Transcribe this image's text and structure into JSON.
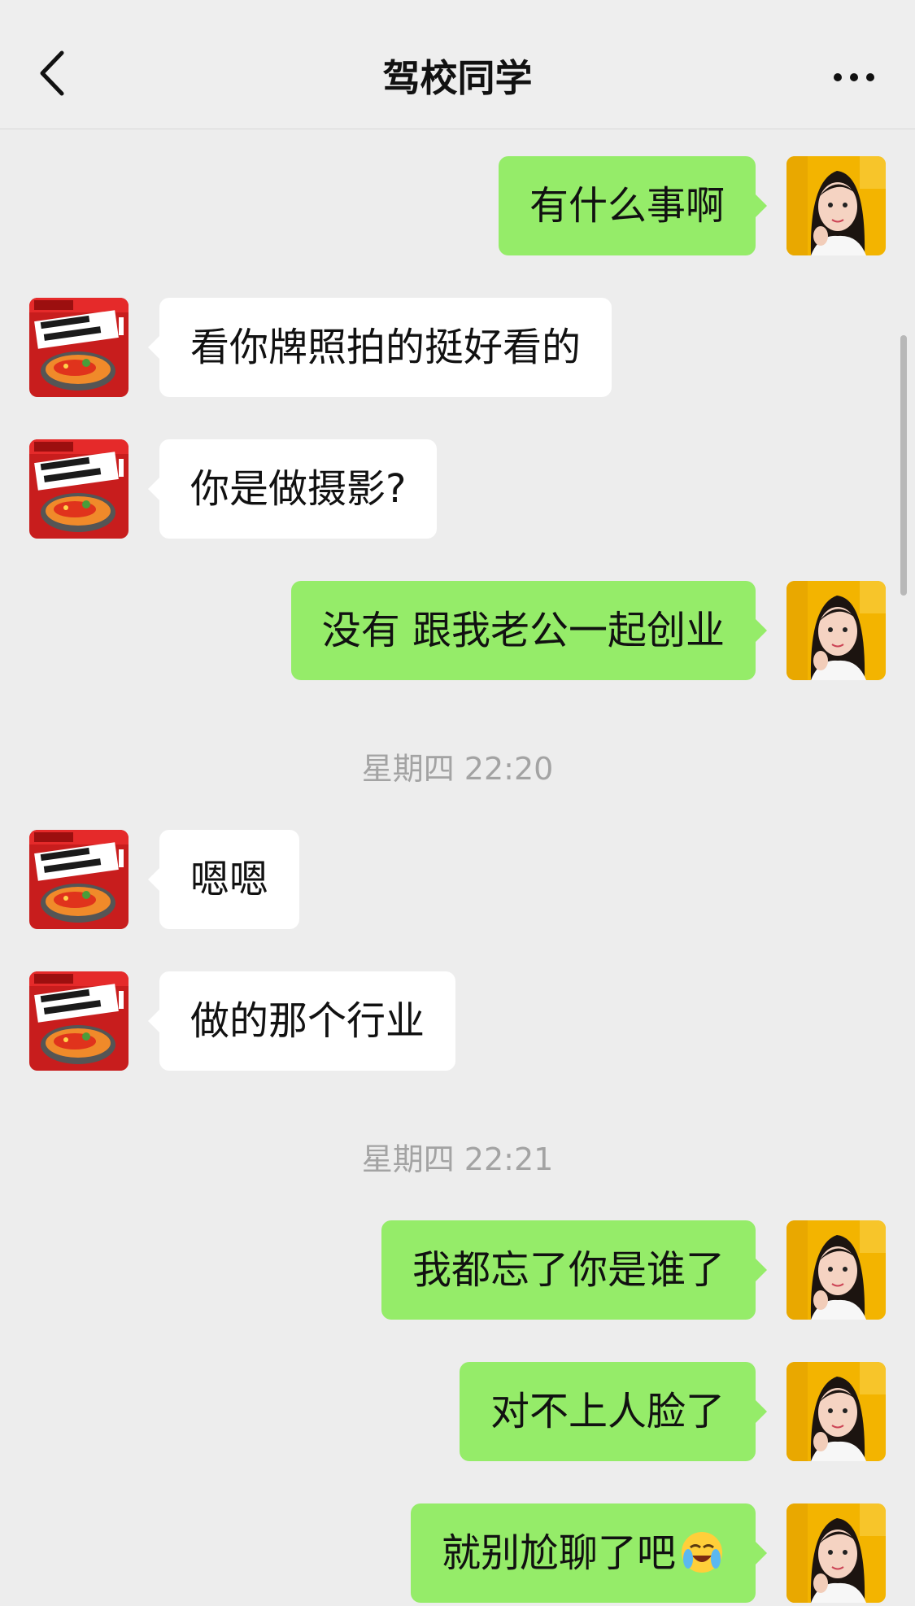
{
  "header": {
    "title": "驾校同学",
    "back_icon": "chevron-left-icon",
    "more_icon": "more-dots-icon"
  },
  "colors": {
    "self_bubble": "#95ec69",
    "other_bubble": "#ffffff",
    "background": "#ededed",
    "timestamp": "#a3a3a3"
  },
  "messages": [
    {
      "sender": "self",
      "text": "有什么事啊"
    },
    {
      "sender": "other",
      "text": "看你牌照拍的挺好看的"
    },
    {
      "sender": "other",
      "text": "你是做摄影?"
    },
    {
      "sender": "self",
      "text": "没有 跟我老公一起创业"
    },
    {
      "sender": "other",
      "text": "嗯嗯"
    },
    {
      "sender": "other",
      "text": "做的那个行业"
    },
    {
      "sender": "self",
      "text": "我都忘了你是谁了"
    },
    {
      "sender": "self",
      "text": "对不上人脸了"
    },
    {
      "sender": "self",
      "text": "就别尬聊了吧",
      "emoji": "crying-face"
    }
  ],
  "timestamps": [
    "星期四 22:20",
    "星期四 22:21"
  ],
  "other_avatar": {
    "logo_text": "钱记神话",
    "icon": "fish-dish-avatar"
  },
  "self_avatar": {
    "icon": "girl-portrait-avatar"
  }
}
